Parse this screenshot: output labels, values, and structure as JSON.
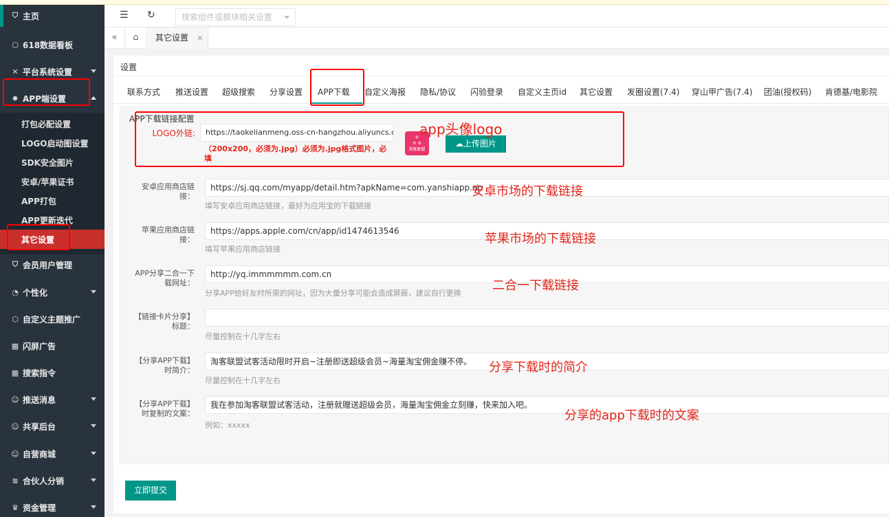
{
  "sidebar": {
    "items": [
      {
        "label": "主页",
        "icon": "shield-icon",
        "glyph": "⛉"
      },
      {
        "label": "618数据看板",
        "icon": "cube-icon",
        "glyph": "⬡"
      },
      {
        "label": "平台系统设置",
        "icon": "tools-icon",
        "glyph": "✕"
      },
      {
        "label": "APP端设置",
        "icon": "gear-icon",
        "glyph": "✹"
      },
      {
        "label": "会员用户管理",
        "icon": "shield-icon",
        "glyph": "⛉"
      },
      {
        "label": "个性化",
        "icon": "palette-icon",
        "glyph": "◔"
      },
      {
        "label": "自定义主题推广",
        "icon": "cube-icon",
        "glyph": "⬡"
      },
      {
        "label": "闪屏广告",
        "icon": "grid-icon",
        "glyph": "▦"
      },
      {
        "label": "搜索指令",
        "icon": "grid-icon",
        "glyph": "▦"
      },
      {
        "label": "推送消息",
        "icon": "user-icon",
        "glyph": "☺"
      },
      {
        "label": "共享后台",
        "icon": "user-icon",
        "glyph": "☺"
      },
      {
        "label": "自营商城",
        "icon": "user-icon",
        "glyph": "☺"
      },
      {
        "label": "合伙人分销",
        "icon": "layers-icon",
        "glyph": "≋"
      },
      {
        "label": "资金管理",
        "icon": "coin-icon",
        "glyph": "♛"
      }
    ],
    "submenu": [
      "打包必配设置",
      "LOGO启动图设置",
      "SDK安全图片",
      "安卓/苹果证书",
      "APP打包",
      "APP更新迭代",
      "其它设置"
    ]
  },
  "toolbar": {
    "search_placeholder": "搜索组件或模块相关设置",
    "menu_glyph": "☰",
    "refresh_glyph": "↻"
  },
  "tabbar": {
    "prev_glyph": "«",
    "home_glyph": "⌂",
    "active_tab": "其它设置",
    "close_glyph": "×"
  },
  "card": {
    "title": "设置",
    "tabs": [
      "联系方式",
      "推送设置",
      "超级搜索",
      "分享设置",
      "APP下载",
      "自定义海报",
      "隐私/协议",
      "闪验登录",
      "自定义主页id",
      "其它设置",
      "发圈设置(7.4)",
      "穿山甲广告(7.4)",
      "团油(授权码)",
      "肯德基/电影院"
    ],
    "active_tab_index": 4
  },
  "panel": {
    "title": "APP下载链接配置",
    "logo": {
      "label": "LOGO外链:",
      "value": "https://taokelianmeng.oss-cn-hangzhou.aliyuncs.co",
      "warning": "（200x200，必须为.jpg）必须为.jpg格式图片，必填",
      "upload_label": "上传图片",
      "upload_glyph": "☁",
      "note": "app头像logo",
      "thumb_text": "淘客联盟"
    },
    "fields": [
      {
        "label": "安卓应用商店链接：",
        "value": "https://sj.qq.com/myapp/detail.htm?apkName=com.yanshiapp.ap",
        "hint": "填写安卓应用商店链接，最好为应用宝的下载链接",
        "note": "安卓市场的下载链接"
      },
      {
        "label": "苹果应用商店链接：",
        "value": "https://apps.apple.com/cn/app/id1474613546",
        "hint": "填写苹果应用商店链接",
        "note": "苹果市场的下载链接"
      },
      {
        "label": "APP分享二合一下载网址：",
        "value": "http://yq.immmmmm.com.cn",
        "hint": "分享APP给好友时所需的网址，因为大量分享可能会造成屏蔽，建议自行更换",
        "note": "二合一下载链接"
      },
      {
        "label": "【链接卡片分享】标题：",
        "value": "",
        "hint": "尽量控制在十几字左右",
        "note": ""
      },
      {
        "label": "【分享APP下载】时简介：",
        "value": "淘客联盟试客活动限时开启~注册即送超级会员~海量淘宝佣金赚不停。",
        "hint": "尽量控制在十几字左右",
        "note": "分享下载时的简介"
      },
      {
        "label": "【分享APP下载】时复制的文案：",
        "value": "我在参加淘客联盟试客活动，注册就赠送超级会员，海量淘宝佣金立刻赚，快来加入吧。",
        "hint": "例如：xxxxx",
        "note": "分享的app下载时的文案"
      }
    ]
  },
  "submit_label": "立即提交",
  "colors": {
    "accent": "#009688",
    "sidebar": "#28333e",
    "annotation": "#e3261b",
    "active_submenu": "#c9302c"
  }
}
